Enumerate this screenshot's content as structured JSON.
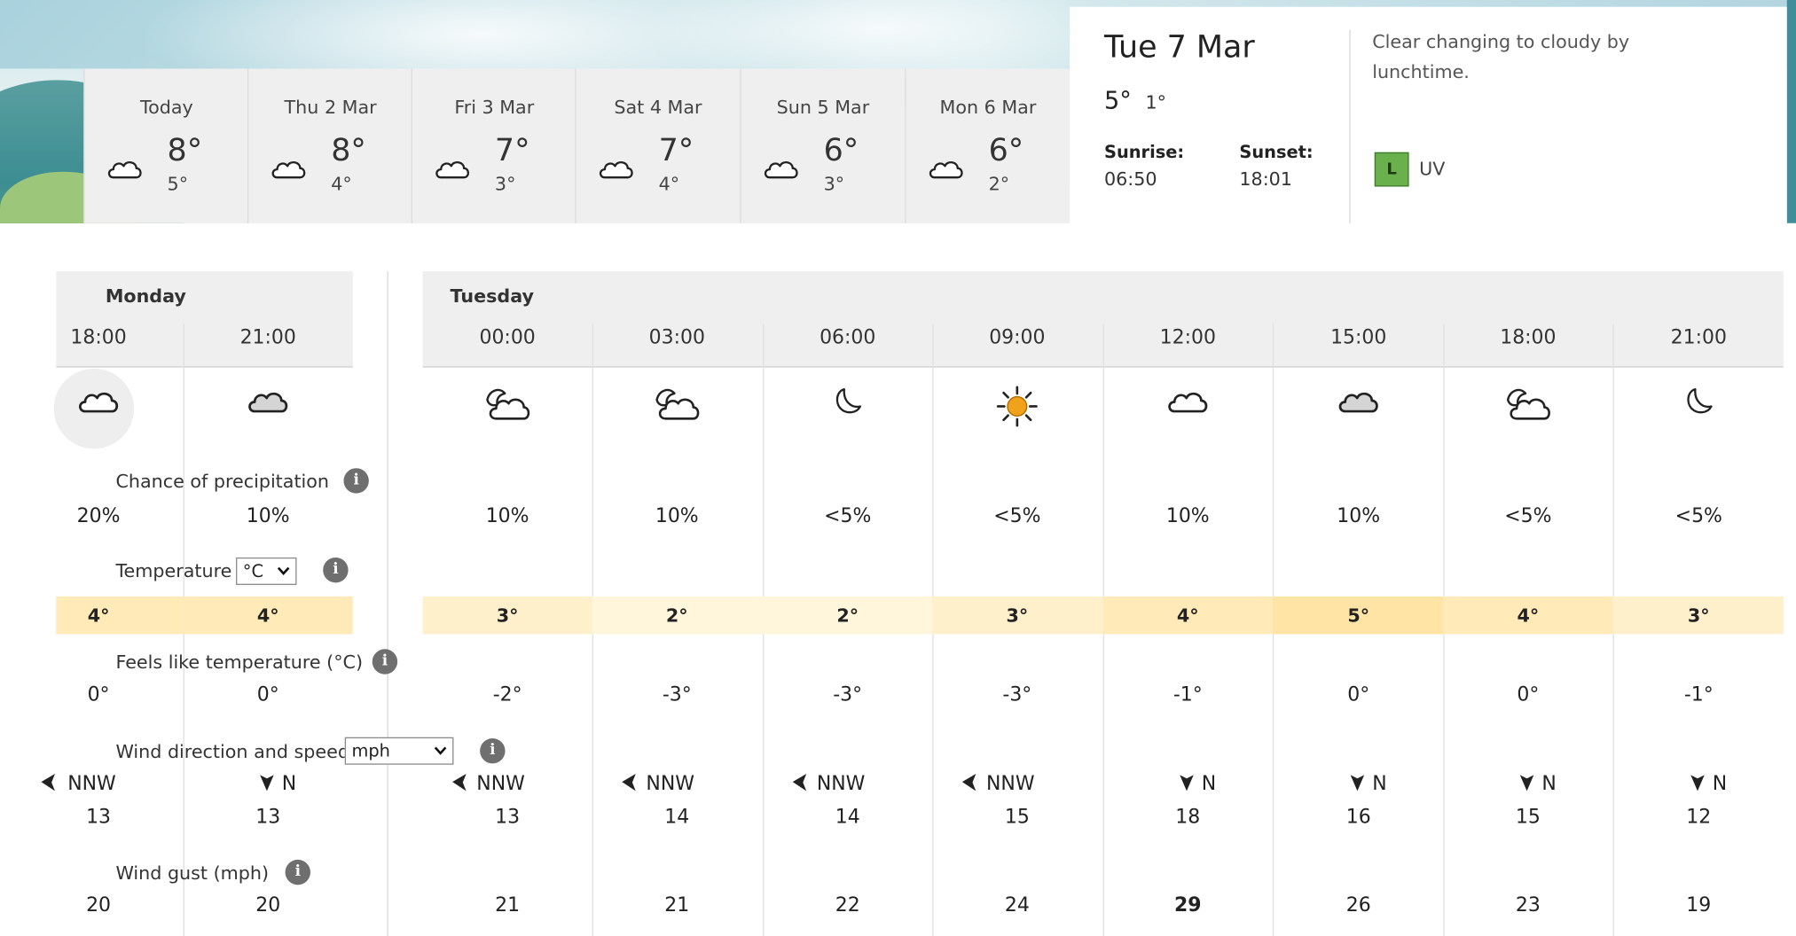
{
  "days": [
    {
      "name": "Today",
      "icon": "cloud-icon",
      "max": "8°",
      "min": "5°"
    },
    {
      "name": "Thu 2 Mar",
      "icon": "cloud-icon",
      "max": "8°",
      "min": "4°"
    },
    {
      "name": "Fri 3 Mar",
      "icon": "cloud-icon",
      "max": "7°",
      "min": "3°"
    },
    {
      "name": "Sat 4 Mar",
      "icon": "cloud-icon",
      "max": "7°",
      "min": "4°"
    },
    {
      "name": "Sun 5 Mar",
      "icon": "cloud-icon",
      "max": "6°",
      "min": "3°"
    },
    {
      "name": "Mon 6 Mar",
      "icon": "cloud-icon",
      "max": "6°",
      "min": "2°"
    }
  ],
  "selected": {
    "date": "Tue 7 Mar",
    "max": "5°",
    "min": "1°",
    "sunrise_label": "Sunrise:",
    "sunrise": "06:50",
    "sunset_label": "Sunset:",
    "sunset": "18:01",
    "description": "Clear changing to cloudy by lunchtime.",
    "uv_level": "L",
    "uv_label": "UV"
  },
  "hourly": {
    "monday_label": "Monday",
    "tuesday_label": "Tuesday",
    "labels": {
      "precip": "Chance of precipitation",
      "temp": "Temperature",
      "temp_unit": "°C",
      "feels": "Feels like temperature (°C)",
      "wind": "Wind direction and speed",
      "wind_unit": "mph",
      "gust": "Wind gust (mph)",
      "info": "i"
    },
    "columns": [
      {
        "time": "18:00",
        "icon": "cloud-icon",
        "precip": "20%",
        "temp": "4°",
        "feels": "0°",
        "wind_dir": "NNW",
        "wind_icon": "wind-arrow-nnw-icon",
        "wind_speed": "13",
        "gust": "20"
      },
      {
        "time": "21:00",
        "icon": "cloud-icon",
        "precip": "10%",
        "temp": "4°",
        "feels": "0°",
        "wind_dir": "N",
        "wind_icon": "wind-arrow-n-icon",
        "wind_speed": "13",
        "gust": "20"
      },
      {
        "time": "00:00",
        "icon": "partly-cloudy-night-icon",
        "precip": "10%",
        "temp": "3°",
        "feels": "-2°",
        "wind_dir": "NNW",
        "wind_icon": "wind-arrow-nnw-icon",
        "wind_speed": "13",
        "gust": "21"
      },
      {
        "time": "03:00",
        "icon": "partly-cloudy-night-icon",
        "precip": "10%",
        "temp": "2°",
        "feels": "-3°",
        "wind_dir": "NNW",
        "wind_icon": "wind-arrow-nnw-icon",
        "wind_speed": "14",
        "gust": "21"
      },
      {
        "time": "06:00",
        "icon": "moon-icon",
        "precip": "<5%",
        "temp": "2°",
        "feels": "-3°",
        "wind_dir": "NNW",
        "wind_icon": "wind-arrow-nnw-icon",
        "wind_speed": "14",
        "gust": "22"
      },
      {
        "time": "09:00",
        "icon": "sun-icon",
        "precip": "<5%",
        "temp": "3°",
        "feels": "-3°",
        "wind_dir": "NNW",
        "wind_icon": "wind-arrow-nnw-icon",
        "wind_speed": "15",
        "gust": "24"
      },
      {
        "time": "12:00",
        "icon": "cloud-icon",
        "precip": "10%",
        "temp": "4°",
        "feels": "-1°",
        "wind_dir": "N",
        "wind_icon": "wind-arrow-n-icon",
        "wind_speed": "18",
        "gust": "29"
      },
      {
        "time": "15:00",
        "icon": "cloud-icon",
        "precip": "10%",
        "temp": "5°",
        "feels": "0°",
        "wind_dir": "N",
        "wind_icon": "wind-arrow-n-icon",
        "wind_speed": "16",
        "gust": "26"
      },
      {
        "time": "18:00",
        "icon": "partly-cloudy-night-icon",
        "precip": "<5%",
        "temp": "4°",
        "feels": "0°",
        "wind_dir": "N",
        "wind_icon": "wind-arrow-n-icon",
        "wind_speed": "15",
        "gust": "23"
      },
      {
        "time": "21:00",
        "icon": "moon-icon",
        "precip": "<5%",
        "temp": "3°",
        "feels": "-1°",
        "wind_dir": "N",
        "wind_icon": "wind-arrow-n-icon",
        "wind_speed": "12",
        "gust": "19"
      }
    ]
  },
  "colors": {
    "temp_2": "#fff6dc",
    "temp_3": "#fff0cc",
    "temp_4": "#ffeab8",
    "temp_5": "#ffe4a6",
    "uv_low": "#6ab04c",
    "sun": "#f0a21b"
  }
}
